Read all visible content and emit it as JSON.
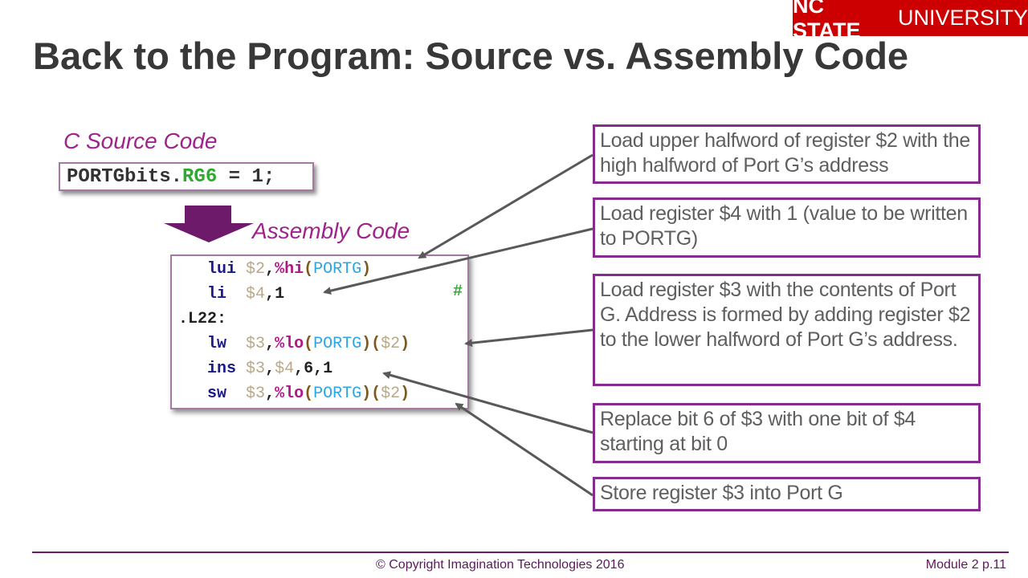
{
  "logo": {
    "bold": "NC STATE",
    "regular": "UNIVERSITY",
    "color": "#cc0000"
  },
  "title": "Back to the Program: Source vs. Assembly Code",
  "c_source": {
    "label": "C Source Code",
    "code": {
      "prefix": "PORTGbits.",
      "member": "RG6",
      "suffix": " = 1;"
    }
  },
  "assembly": {
    "label": "Assembly Code",
    "lines": [
      {
        "indent": "   ",
        "mnemonic": "lui",
        "pad": " ",
        "parts": [
          {
            "t": "reg",
            "v": "$2"
          },
          {
            "t": "num",
            "v": ","
          },
          {
            "t": "pct",
            "v": "%hi"
          },
          {
            "t": "paren",
            "v": "("
          },
          {
            "t": "port",
            "v": "PORTG"
          },
          {
            "t": "paren",
            "v": ")"
          }
        ]
      },
      {
        "indent": "   ",
        "mnemonic": "li",
        "pad": "  ",
        "parts": [
          {
            "t": "reg",
            "v": "$4"
          },
          {
            "t": "num",
            "v": ",1"
          }
        ]
      },
      {
        "indent": "",
        "mnemonic": "",
        "pad": "",
        "parts": [
          {
            "t": "lbl",
            "v": ".L22:"
          }
        ]
      },
      {
        "indent": "   ",
        "mnemonic": "lw",
        "pad": "  ",
        "parts": [
          {
            "t": "reg",
            "v": "$3"
          },
          {
            "t": "num",
            "v": ","
          },
          {
            "t": "pct",
            "v": "%lo"
          },
          {
            "t": "paren",
            "v": "("
          },
          {
            "t": "port",
            "v": "PORTG"
          },
          {
            "t": "paren",
            "v": ")("
          },
          {
            "t": "reg",
            "v": "$2"
          },
          {
            "t": "paren",
            "v": ")"
          }
        ]
      },
      {
        "indent": "   ",
        "mnemonic": "ins",
        "pad": " ",
        "parts": [
          {
            "t": "reg",
            "v": "$3"
          },
          {
            "t": "num",
            "v": ","
          },
          {
            "t": "reg",
            "v": "$4"
          },
          {
            "t": "num",
            "v": ",6,1"
          }
        ]
      },
      {
        "indent": "   ",
        "mnemonic": "sw",
        "pad": "  ",
        "parts": [
          {
            "t": "reg",
            "v": "$3"
          },
          {
            "t": "num",
            "v": ","
          },
          {
            "t": "pct",
            "v": "%lo"
          },
          {
            "t": "paren",
            "v": "("
          },
          {
            "t": "port",
            "v": "PORTG"
          },
          {
            "t": "paren",
            "v": ")("
          },
          {
            "t": "reg",
            "v": "$2"
          },
          {
            "t": "paren",
            "v": ")"
          }
        ]
      }
    ],
    "comment_marker": "#"
  },
  "notes": [
    "Load upper halfword of register $2 with the high halfword of Port G’s address",
    "Load register $4 with 1 (value to be written to PORTG)",
    "Load register $3 with the contents of Port G. Address is formed by adding register $2 to the lower halfword of Port G’s address.",
    "Replace bit 6 of $3 with one bit of $4 starting at bit 0",
    "Store register $3 into Port G"
  ],
  "footer": {
    "copyright": "© Copyright Imagination Technologies 2016",
    "page": "Module 2 p.11"
  }
}
